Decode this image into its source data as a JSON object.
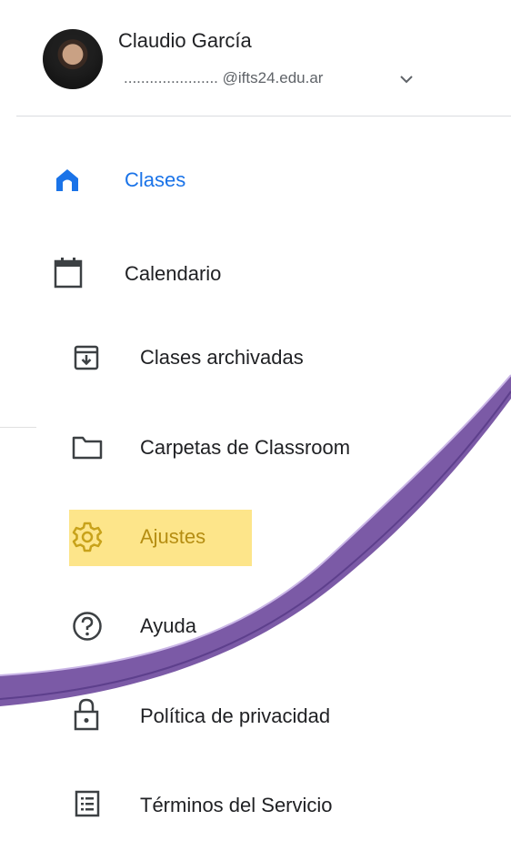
{
  "account": {
    "name": "Claudio García",
    "email": "...................... @ifts24.edu.ar"
  },
  "nav": {
    "clases": "Clases",
    "calendario": "Calendario",
    "clases_archivadas": "Clases archivadas",
    "carpetas": "Carpetas de Classroom",
    "ajustes": "Ajustes",
    "ayuda": "Ayuda",
    "privacidad": "Política de privacidad",
    "terminos": "Términos del Servicio"
  },
  "colors": {
    "active": "#1a73e8",
    "highlight": "#fde58a",
    "settings_active": "#c8a21a",
    "swoosh": "#7b5aa6"
  },
  "icons": {
    "clases": "home-icon",
    "calendario": "calendar-icon",
    "clases_archivadas": "archive-icon",
    "carpetas": "folder-icon",
    "ajustes": "gear-icon",
    "ayuda": "help-icon",
    "privacidad": "lock-icon",
    "terminos": "document-list-icon"
  }
}
